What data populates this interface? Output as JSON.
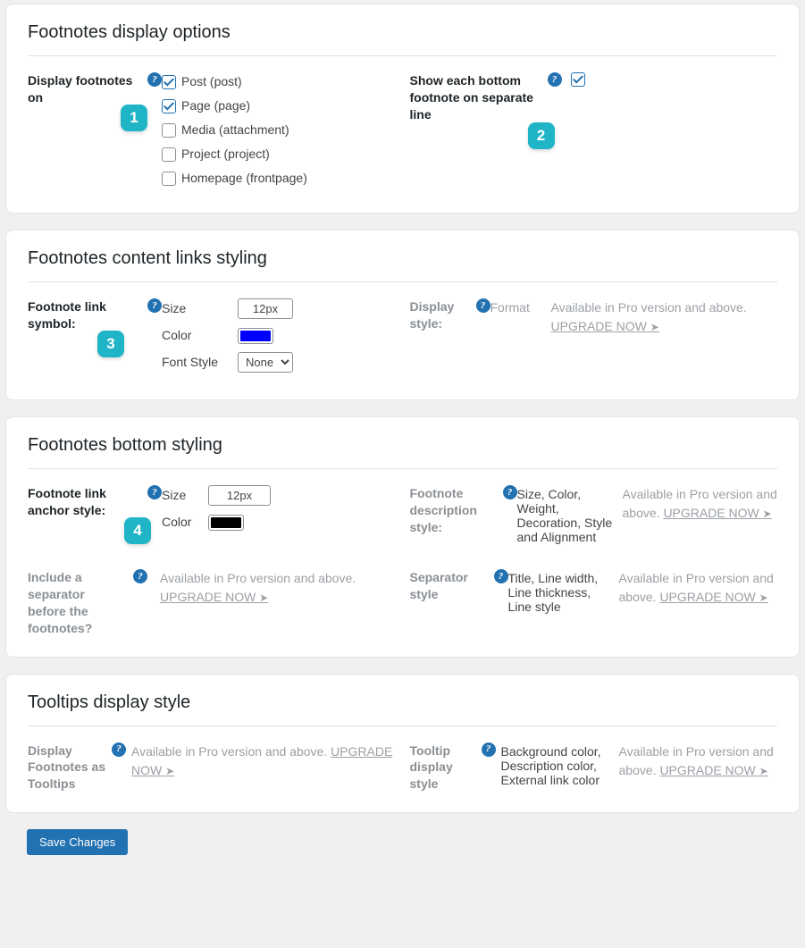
{
  "help_glyph": "?",
  "arrow_glyph": "➤",
  "pro_msg": "Available in Pro version and above. ",
  "upgrade_label": "UPGRADE NOW ",
  "section1": {
    "title": "Footnotes display options",
    "display_on_label": "Display footnotes on",
    "badge1": "1",
    "checkboxes": [
      {
        "label": "Post (post)",
        "checked": true
      },
      {
        "label": "Page (page)",
        "checked": true
      },
      {
        "label": "Media (attachment)",
        "checked": false
      },
      {
        "label": "Project (project)",
        "checked": false
      },
      {
        "label": "Homepage (frontpage)",
        "checked": false
      }
    ],
    "show_each_label": "Show each bottom footnote on separate line",
    "badge2": "2",
    "show_each_checked": true
  },
  "section2": {
    "title": "Footnotes content links styling",
    "link_symbol_label": "Footnote link symbol:",
    "badge3": "3",
    "size_label": "Size",
    "size_value": "12px",
    "color_label": "Color",
    "color_value": "#0000ff",
    "font_style_label": "Font Style",
    "font_style_value": "None",
    "display_style_label": "Display style:",
    "format_sub": "Format"
  },
  "section3": {
    "title": "Footnotes bottom styling",
    "anchor_label": "Footnote link anchor style:",
    "badge4": "4",
    "size_label": "Size",
    "size_value": "12px",
    "color_label": "Color",
    "color_value": "#000000",
    "desc_label": "Footnote description style:",
    "desc_sub": "Size, Color, Weight, Decoration, Style and Alignment",
    "separator_before_label": "Include a separator before the footnotes?",
    "separator_style_label": "Separator style",
    "separator_sub": "Title, Line width, Line thickness, Line style"
  },
  "section4": {
    "title": "Tooltips display style",
    "tooltips_label": "Display Footnotes as Tooltips",
    "tooltip_style_label": "Tooltip display style",
    "tooltip_sub": "Background color, Description color, External link color"
  },
  "save_label": "Save Changes"
}
